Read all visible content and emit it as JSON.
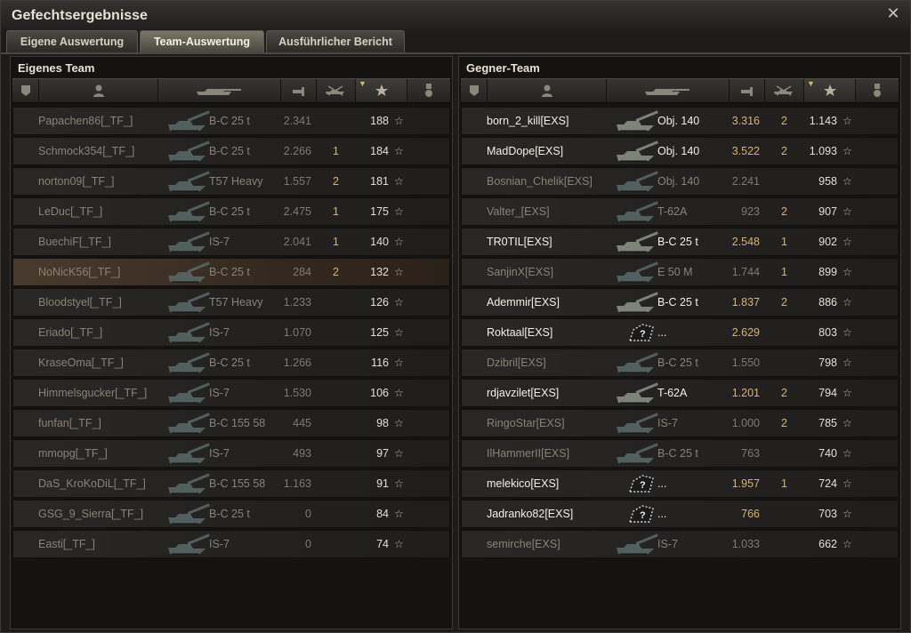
{
  "window": {
    "title": "Gefechtsergebnisse",
    "close_glyph": "✕"
  },
  "tabs": [
    {
      "label": "Eigene Auswertung",
      "active": false
    },
    {
      "label": "Team-Auswertung",
      "active": true
    },
    {
      "label": "Ausführlicher Bericht",
      "active": false
    }
  ],
  "columns": {
    "icons": [
      "rank-icon",
      "player-icon",
      "tank-icon",
      "xp-icon",
      "kills-icon",
      "score-star-icon",
      "medal-icon"
    ],
    "sorted_by": "score"
  },
  "own_team": {
    "title": "Eigenes Team",
    "rows": [
      {
        "name": "Papachen86[_TF_]",
        "vehicle": "B-C 25 t",
        "xp": "2.341",
        "kills": "",
        "score": "188",
        "me": false
      },
      {
        "name": "Schmock354[_TF_]",
        "vehicle": "B-C 25 t",
        "xp": "2.266",
        "kills": "1",
        "score": "184",
        "me": false
      },
      {
        "name": "norton09[_TF_]",
        "vehicle": "T57 Heavy",
        "xp": "1.557",
        "kills": "2",
        "score": "181",
        "me": false
      },
      {
        "name": "LeDuc[_TF_]",
        "vehicle": "B-C 25 t",
        "xp": "2.475",
        "kills": "1",
        "score": "175",
        "me": false
      },
      {
        "name": "BuechiF[_TF_]",
        "vehicle": "IS-7",
        "xp": "2.041",
        "kills": "1",
        "score": "140",
        "me": false
      },
      {
        "name": "NoNicK56[_TF_]",
        "vehicle": "B-C 25 t",
        "xp": "284",
        "kills": "2",
        "score": "132",
        "me": true
      },
      {
        "name": "Bloodstyel[_TF_]",
        "vehicle": "T57 Heavy",
        "xp": "1.233",
        "kills": "",
        "score": "126",
        "me": false
      },
      {
        "name": "Eriado[_TF_]",
        "vehicle": "IS-7",
        "xp": "1.070",
        "kills": "",
        "score": "125",
        "me": false
      },
      {
        "name": "KraseOma[_TF_]",
        "vehicle": "B-C 25 t",
        "xp": "1.266",
        "kills": "",
        "score": "116",
        "me": false
      },
      {
        "name": "Himmelsgucker[_TF_]",
        "vehicle": "IS-7",
        "xp": "1.530",
        "kills": "",
        "score": "106",
        "me": false
      },
      {
        "name": "funfan[_TF_]",
        "vehicle": "B-C 155 58",
        "xp": "445",
        "kills": "",
        "score": "98",
        "me": false
      },
      {
        "name": "mmopg[_TF_]",
        "vehicle": "IS-7",
        "xp": "493",
        "kills": "",
        "score": "97",
        "me": false
      },
      {
        "name": "DaS_KroKoDiL[_TF_]",
        "vehicle": "B-C 155 58",
        "xp": "1.163",
        "kills": "",
        "score": "91",
        "me": false
      },
      {
        "name": "GSG_9_Sierra[_TF_]",
        "vehicle": "B-C 25 t",
        "xp": "0",
        "kills": "",
        "score": "84",
        "me": false
      },
      {
        "name": "Easti[_TF_]",
        "vehicle": "IS-7",
        "xp": "0",
        "kills": "",
        "score": "74",
        "me": false
      }
    ]
  },
  "enemy_team": {
    "title": "Gegner-Team",
    "rows": [
      {
        "name": "born_2_kill[EXS]",
        "vehicle": "Obj. 140",
        "xp": "3.316",
        "kills": "2",
        "score": "1.143",
        "alive": true,
        "unknown": false
      },
      {
        "name": "MadDope[EXS]",
        "vehicle": "Obj. 140",
        "xp": "3.522",
        "kills": "2",
        "score": "1.093",
        "alive": true,
        "unknown": false
      },
      {
        "name": "Bosnian_Chelik[EXS]",
        "vehicle": "Obj. 140",
        "xp": "2.241",
        "kills": "",
        "score": "958",
        "alive": false,
        "unknown": false
      },
      {
        "name": "Valter_[EXS]",
        "vehicle": "T-62A",
        "xp": "923",
        "kills": "2",
        "score": "907",
        "alive": false,
        "unknown": false
      },
      {
        "name": "TR0TIL[EXS]",
        "vehicle": "B-C 25 t",
        "xp": "2.548",
        "kills": "1",
        "score": "902",
        "alive": true,
        "unknown": false
      },
      {
        "name": "SanjinX[EXS]",
        "vehicle": "E 50 M",
        "xp": "1.744",
        "kills": "1",
        "score": "899",
        "alive": false,
        "unknown": false
      },
      {
        "name": "Ademmir[EXS]",
        "vehicle": "B-C 25 t",
        "xp": "1.837",
        "kills": "2",
        "score": "886",
        "alive": true,
        "unknown": false
      },
      {
        "name": "Roktaal[EXS]",
        "vehicle": "...",
        "xp": "2.629",
        "kills": "",
        "score": "803",
        "alive": true,
        "unknown": true
      },
      {
        "name": "Dzibril[EXS]",
        "vehicle": "B-C 25 t",
        "xp": "1.550",
        "kills": "",
        "score": "798",
        "alive": false,
        "unknown": false
      },
      {
        "name": "rdjavzilet[EXS]",
        "vehicle": "T-62A",
        "xp": "1.201",
        "kills": "2",
        "score": "794",
        "alive": true,
        "unknown": false
      },
      {
        "name": "RingoStar[EXS]",
        "vehicle": "IS-7",
        "xp": "1.000",
        "kills": "2",
        "score": "785",
        "alive": false,
        "unknown": false
      },
      {
        "name": "IlHammerII[EXS]",
        "vehicle": "B-C 25 t",
        "xp": "763",
        "kills": "",
        "score": "740",
        "alive": false,
        "unknown": false
      },
      {
        "name": "melekico[EXS]",
        "vehicle": "...",
        "xp": "1.957",
        "kills": "1",
        "score": "724",
        "alive": true,
        "unknown": true
      },
      {
        "name": "Jadranko82[EXS]",
        "vehicle": "...",
        "xp": "766",
        "kills": "",
        "score": "703",
        "alive": true,
        "unknown": true
      },
      {
        "name": "semirche[EXS]",
        "vehicle": "IS-7",
        "xp": "1.033",
        "kills": "",
        "score": "662",
        "alive": false,
        "unknown": false
      }
    ]
  },
  "colors": {
    "accent_gold": "#d7b56d",
    "row_self": "#4a3a2e"
  }
}
